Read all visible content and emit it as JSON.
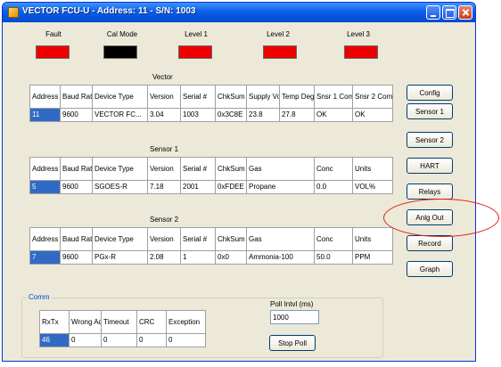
{
  "window": {
    "title": "VECTOR FCU-U - Address: 11 - S/N: 1003"
  },
  "colors": {
    "indicator_red": "#ef0000",
    "indicator_black": "#000000",
    "selection": "#316ac5",
    "highlight_ellipse": "#e01f1f"
  },
  "indicators": [
    {
      "label": "Fault",
      "state": "red"
    },
    {
      "label": "Cal Mode",
      "state": "black"
    },
    {
      "label": "Level 1",
      "state": "red"
    },
    {
      "label": "Level 2",
      "state": "red"
    },
    {
      "label": "Level 3",
      "state": "red"
    }
  ],
  "vector": {
    "title": "Vector",
    "headers": [
      "Address",
      "Baud Rate",
      "Device Type",
      "Version",
      "Serial #",
      "ChkSum",
      "Supply Volts",
      "Temp DegC",
      "Snsr 1 Comm",
      "Snsr 2 Comm"
    ],
    "row": [
      "11",
      "9600",
      "VECTOR FC...",
      "3.04",
      "1003",
      "0x3C8E",
      "23.8",
      "27.8",
      "OK",
      "OK"
    ]
  },
  "sensor1": {
    "title": "Sensor 1",
    "headers": [
      "Address",
      "Baud Rate",
      "Device Type",
      "Version",
      "Serial #",
      "ChkSum",
      "Gas",
      "Conc",
      "Units"
    ],
    "row": [
      "5",
      "9600",
      "SGOES-R",
      "7.18",
      "2001",
      "0xFDEE",
      "Propane",
      "0.0",
      "VOL%"
    ]
  },
  "sensor2": {
    "title": "Sensor 2",
    "headers": [
      "Address",
      "Baud Rate",
      "Device Type",
      "Version",
      "Serial #",
      "ChkSum",
      "Gas",
      "Conc",
      "Units"
    ],
    "row": [
      "7",
      "9600",
      "PGx-R",
      "2.08",
      "1",
      "0x0",
      "Ammonia-100",
      "50.0",
      "PPM"
    ]
  },
  "buttons": {
    "config": "Config",
    "sensor1": "Sensor 1",
    "sensor2": "Sensor 2",
    "hart": "HART",
    "relays": "Relays",
    "anlg_out": "Anlg Out",
    "record": "Record",
    "graph": "Graph"
  },
  "comm": {
    "label": "Comm",
    "headers": [
      "RxTx",
      "Wrong Addr",
      "Timeout",
      "CRC",
      "Exception"
    ],
    "row": [
      "46",
      "0",
      "0",
      "0",
      "0"
    ]
  },
  "poll": {
    "label": "Poll Intvl (ms)",
    "value": "1000",
    "stop_label": "Stop Poll"
  }
}
